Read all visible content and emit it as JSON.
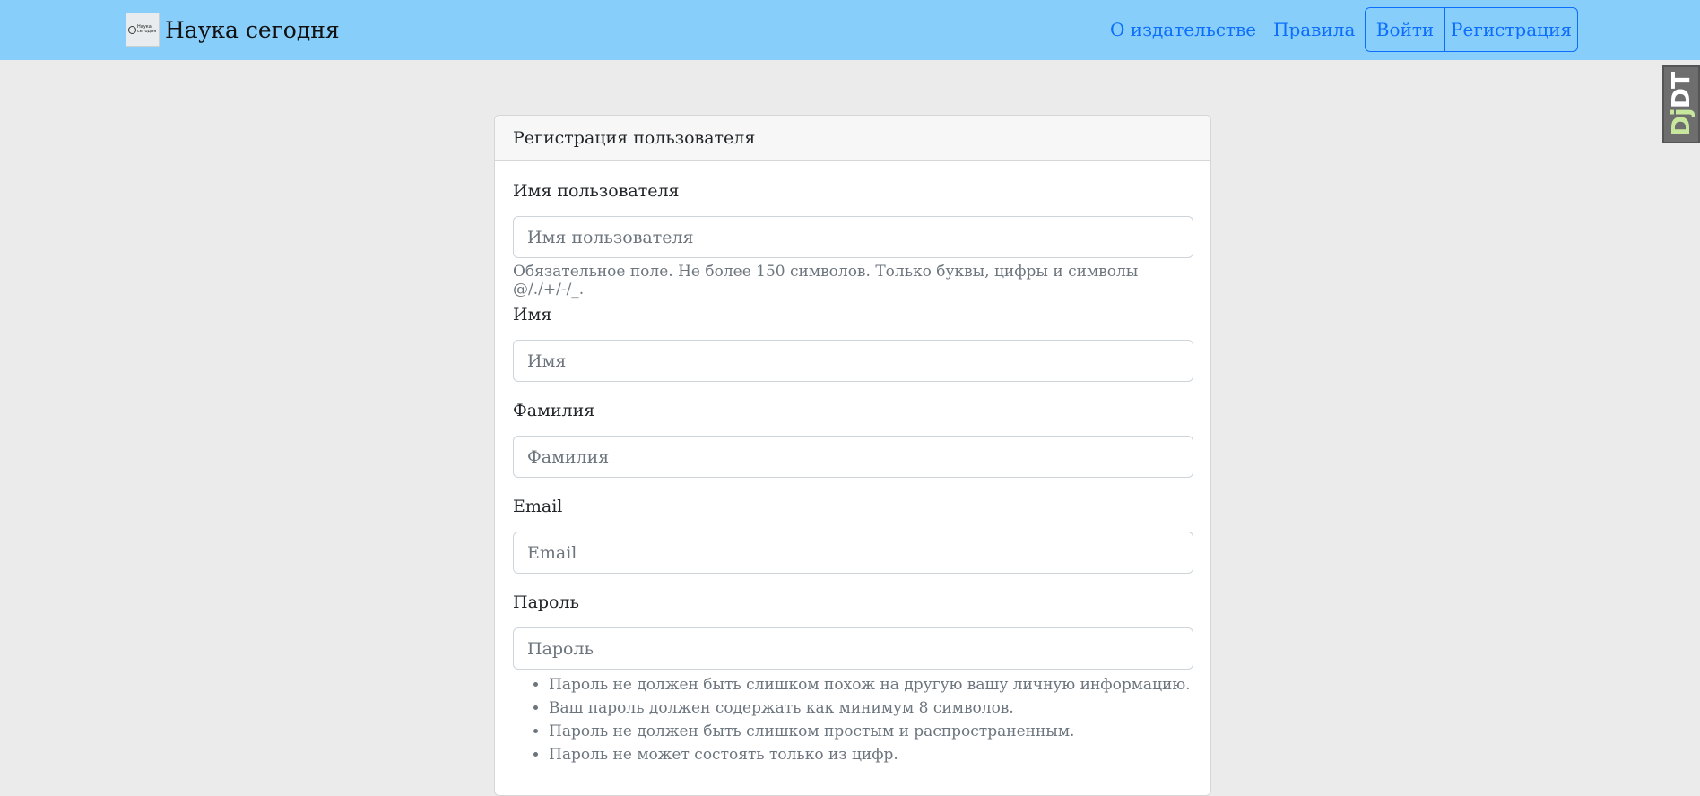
{
  "navbar": {
    "brand_logo_text": "Наука сегодня",
    "brand_title": "Наука сегодня",
    "links": [
      "О издательстве",
      "Правила"
    ],
    "login_label": "Войти",
    "register_label": "Регистрация"
  },
  "debug_toolbar": {
    "dj": "Dj",
    "dt": "DT"
  },
  "form": {
    "header": "Регистрация пользователя",
    "username": {
      "label": "Имя пользователя",
      "placeholder": "Имя пользователя",
      "help": "Обязательное поле. Не более 150 символов. Только буквы, цифры и символы @/./+/-/_."
    },
    "first_name": {
      "label": "Имя",
      "placeholder": "Имя"
    },
    "last_name": {
      "label": "Фамилия",
      "placeholder": "Фамилия"
    },
    "email": {
      "label": "Email",
      "placeholder": "Email"
    },
    "password": {
      "label": "Пароль",
      "placeholder": "Пароль",
      "help_items": [
        "Пароль не должен быть слишком похож на другую вашу личную информацию.",
        "Ваш пароль должен содержать как минимум 8 символов.",
        "Пароль не должен быть слишком простым и распространенным.",
        "Пароль не может состоять только из цифр."
      ]
    }
  },
  "colors": {
    "navbar_bg": "#87cefa",
    "accent": "#0d6efd",
    "page_bg": "#ebebeb"
  }
}
